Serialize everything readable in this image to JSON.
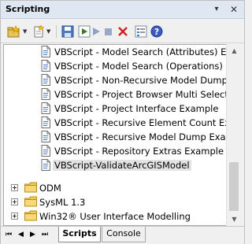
{
  "panel": {
    "title": "Scripting",
    "pin_glyph": "▾",
    "close_glyph": "✕"
  },
  "toolbar": {
    "icons": [
      "new-script-group-icon",
      "new-script-icon",
      "save-icon",
      "run-script-icon",
      "debug-icon",
      "stop-icon",
      "delete-icon",
      "properties-icon",
      "help-icon"
    ]
  },
  "tree": {
    "scripts": [
      "VBScript - Model Search (Attributes) Examp",
      "VBScript - Model Search (Operations) Exam",
      "VBScript - Non-Recursive Model Dump Exa",
      "VBScript - Project Browser Multi Selection",
      "VBScript - Project Interface Example",
      "VBScript - Recursive Element Count Examp",
      "VBScript - Recursive Model Dump Example",
      "VBScript - Repository Extras Example",
      "VBScript-ValidateArcGISModel"
    ],
    "selected_index": 8,
    "groups": [
      "ODM",
      "SysML 1.3",
      "Win32® User Interface Modelling"
    ]
  },
  "bottom": {
    "tabs": [
      "Scripts",
      "Console"
    ],
    "nav_first": "⏮",
    "nav_prev": "◀",
    "nav_next": "▶",
    "nav_last": "⏭"
  }
}
